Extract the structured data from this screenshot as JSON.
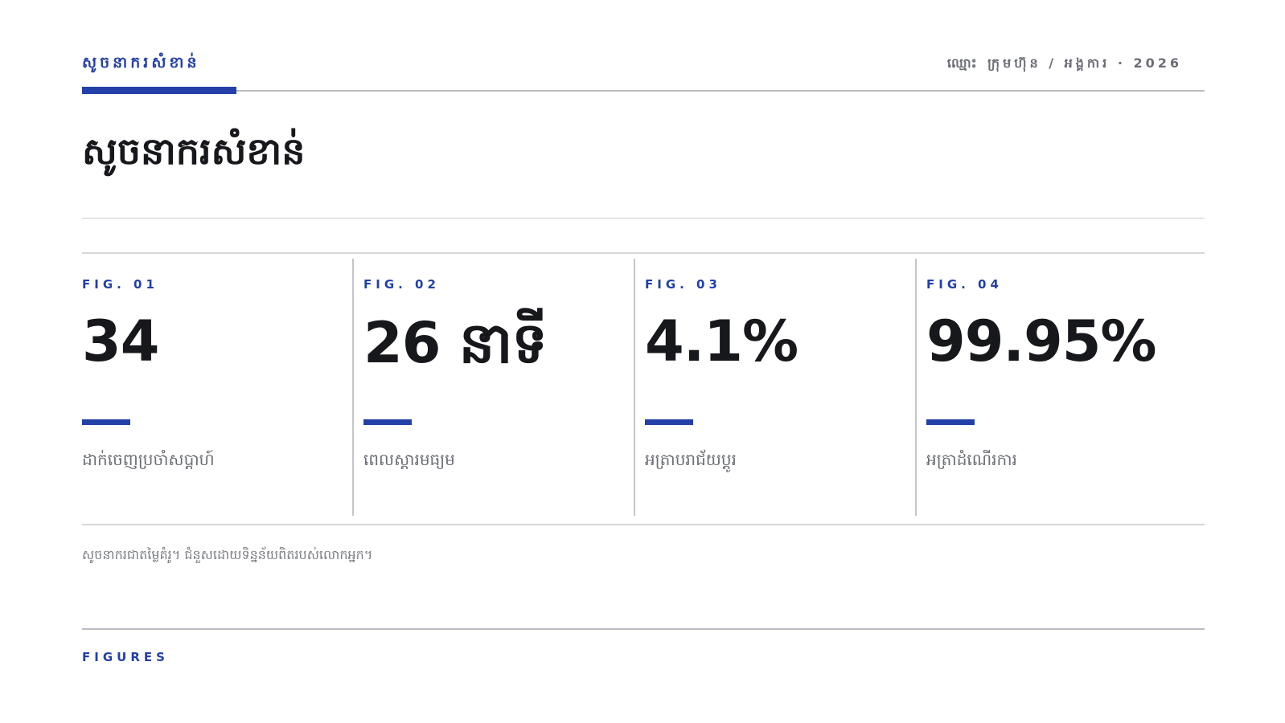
{
  "header": {
    "section_label": "សូចនាករសំខាន់",
    "meta": "ឈ្មោះ ក្រុមហ៊ុន / អង្គការ · 2026"
  },
  "title": "សូចនាករសំខាន់",
  "stats": [
    {
      "label": "FIG. 01",
      "value": "34",
      "caption": "ដាក់ចេញប្រចាំសប្តាហ៍"
    },
    {
      "label": "FIG. 02",
      "value": "26 នាទី",
      "caption": "ពេលស្តារមធ្យម"
    },
    {
      "label": "FIG. 03",
      "value": "4.1%",
      "caption": "អត្រាបរាជ័យប្តូរ"
    },
    {
      "label": "FIG. 04",
      "value": "99.95%",
      "caption": "អត្រាដំណើរការ"
    }
  ],
  "footnote": "សូចនាករជាតម្លៃគំរូ។ ជំនួសដោយទិន្នន័យពិតរបស់លោកអ្នក។",
  "footer": {
    "label": "FIGURES"
  },
  "colors": {
    "accent": "#2340a8",
    "text": "#17181c",
    "muted": "#6b6e75"
  }
}
